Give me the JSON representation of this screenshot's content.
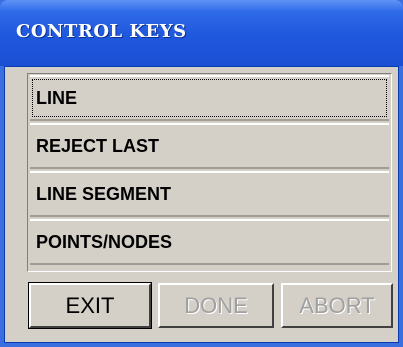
{
  "window": {
    "title": "CONTROL KEYS"
  },
  "list": {
    "items": [
      {
        "label": "LINE"
      },
      {
        "label": "REJECT LAST"
      },
      {
        "label": "LINE SEGMENT"
      },
      {
        "label": "POINTS/NODES"
      }
    ],
    "focused_index": 0
  },
  "buttons": {
    "exit": {
      "label": "EXIT",
      "enabled": true
    },
    "done": {
      "label": "DONE",
      "enabled": false
    },
    "abort": {
      "label": "ABORT",
      "enabled": false
    }
  },
  "colors": {
    "title_bar": "#1f57dd",
    "dialog_face": "#d4d0c8",
    "disabled_text": "#a0a0a0"
  }
}
